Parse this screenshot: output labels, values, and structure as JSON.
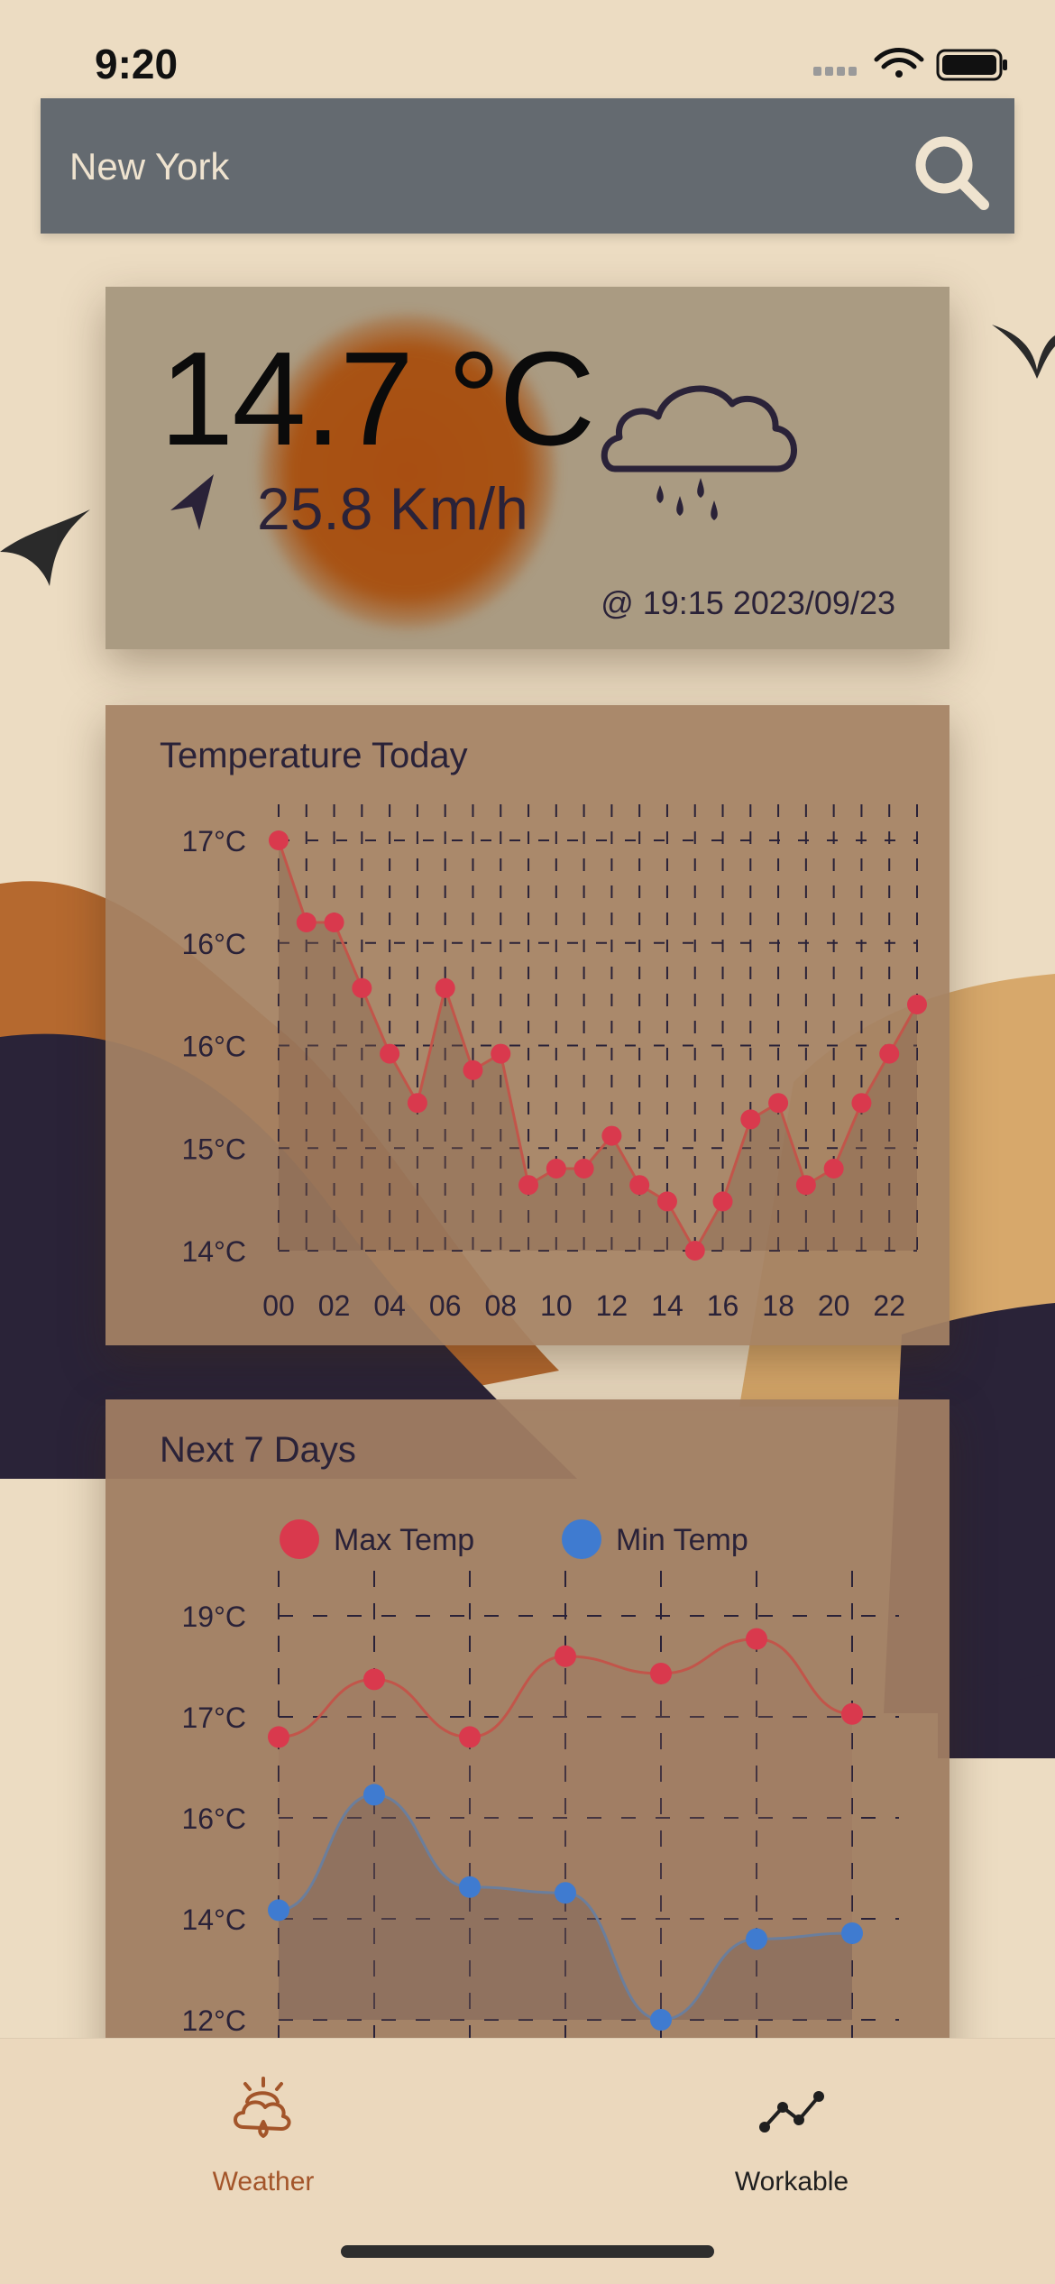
{
  "status": {
    "time": "9:20"
  },
  "search": {
    "placeholder": "New York",
    "value": ""
  },
  "current": {
    "temperature": "14.7 °C",
    "wind": "25.8 Km/h",
    "updated": "@ 19:15 2023/09/23",
    "condition_icon": "cloud-rain-icon",
    "wind_icon": "navigation-arrow-icon"
  },
  "today": {
    "title": "Temperature Today"
  },
  "week": {
    "title": "Next 7 Days"
  },
  "tabs": [
    {
      "label": "Weather",
      "icon": "weather-cloud-sun-icon",
      "active": true
    },
    {
      "label": "Workable",
      "icon": "line-chart-icon",
      "active": false
    }
  ],
  "colors": {
    "accent": "#a3552a",
    "max_series": "#d9394d",
    "min_series": "#3f7bd0",
    "searchbar": "#646a70"
  },
  "chart_data": [
    {
      "type": "line",
      "title": "Temperature Today",
      "x": [
        "00",
        "01",
        "02",
        "03",
        "04",
        "05",
        "06",
        "07",
        "08",
        "09",
        "10",
        "11",
        "12",
        "13",
        "14",
        "15",
        "16",
        "17",
        "18",
        "19",
        "20",
        "21",
        "22",
        "23"
      ],
      "x_tick_labels": [
        "00",
        "02",
        "04",
        "06",
        "08",
        "10",
        "12",
        "14",
        "16",
        "18",
        "20",
        "22"
      ],
      "series": [
        {
          "values": [
            16.9,
            16.4,
            16.4,
            16.0,
            15.6,
            15.3,
            16.0,
            15.5,
            15.6,
            14.8,
            14.9,
            14.9,
            15.1,
            14.8,
            14.7,
            14.4,
            14.7,
            15.2,
            15.3,
            14.8,
            14.9,
            15.3,
            15.6,
            15.9
          ]
        }
      ],
      "y_tick_labels": [
        "17°C",
        "16°C",
        "16°C",
        "15°C",
        "14°C"
      ],
      "ylim": [
        14.4,
        16.9
      ],
      "grid": true,
      "legend": false
    },
    {
      "type": "line",
      "title": "Next 7 Days",
      "x": [
        "1",
        "2",
        "3",
        "4",
        "5",
        "6",
        "7"
      ],
      "series": [
        {
          "name": "Max Temp",
          "values": [
            16.9,
            17.9,
            16.9,
            18.3,
            18.0,
            18.6,
            17.3
          ]
        },
        {
          "name": "Min Temp",
          "values": [
            13.9,
            15.9,
            14.3,
            14.2,
            12.0,
            13.4,
            13.5
          ]
        }
      ],
      "y_tick_labels": [
        "19°C",
        "17°C",
        "16°C",
        "14°C",
        "12°C"
      ],
      "ylim": [
        12,
        19
      ],
      "grid": true,
      "legend": "top"
    }
  ]
}
